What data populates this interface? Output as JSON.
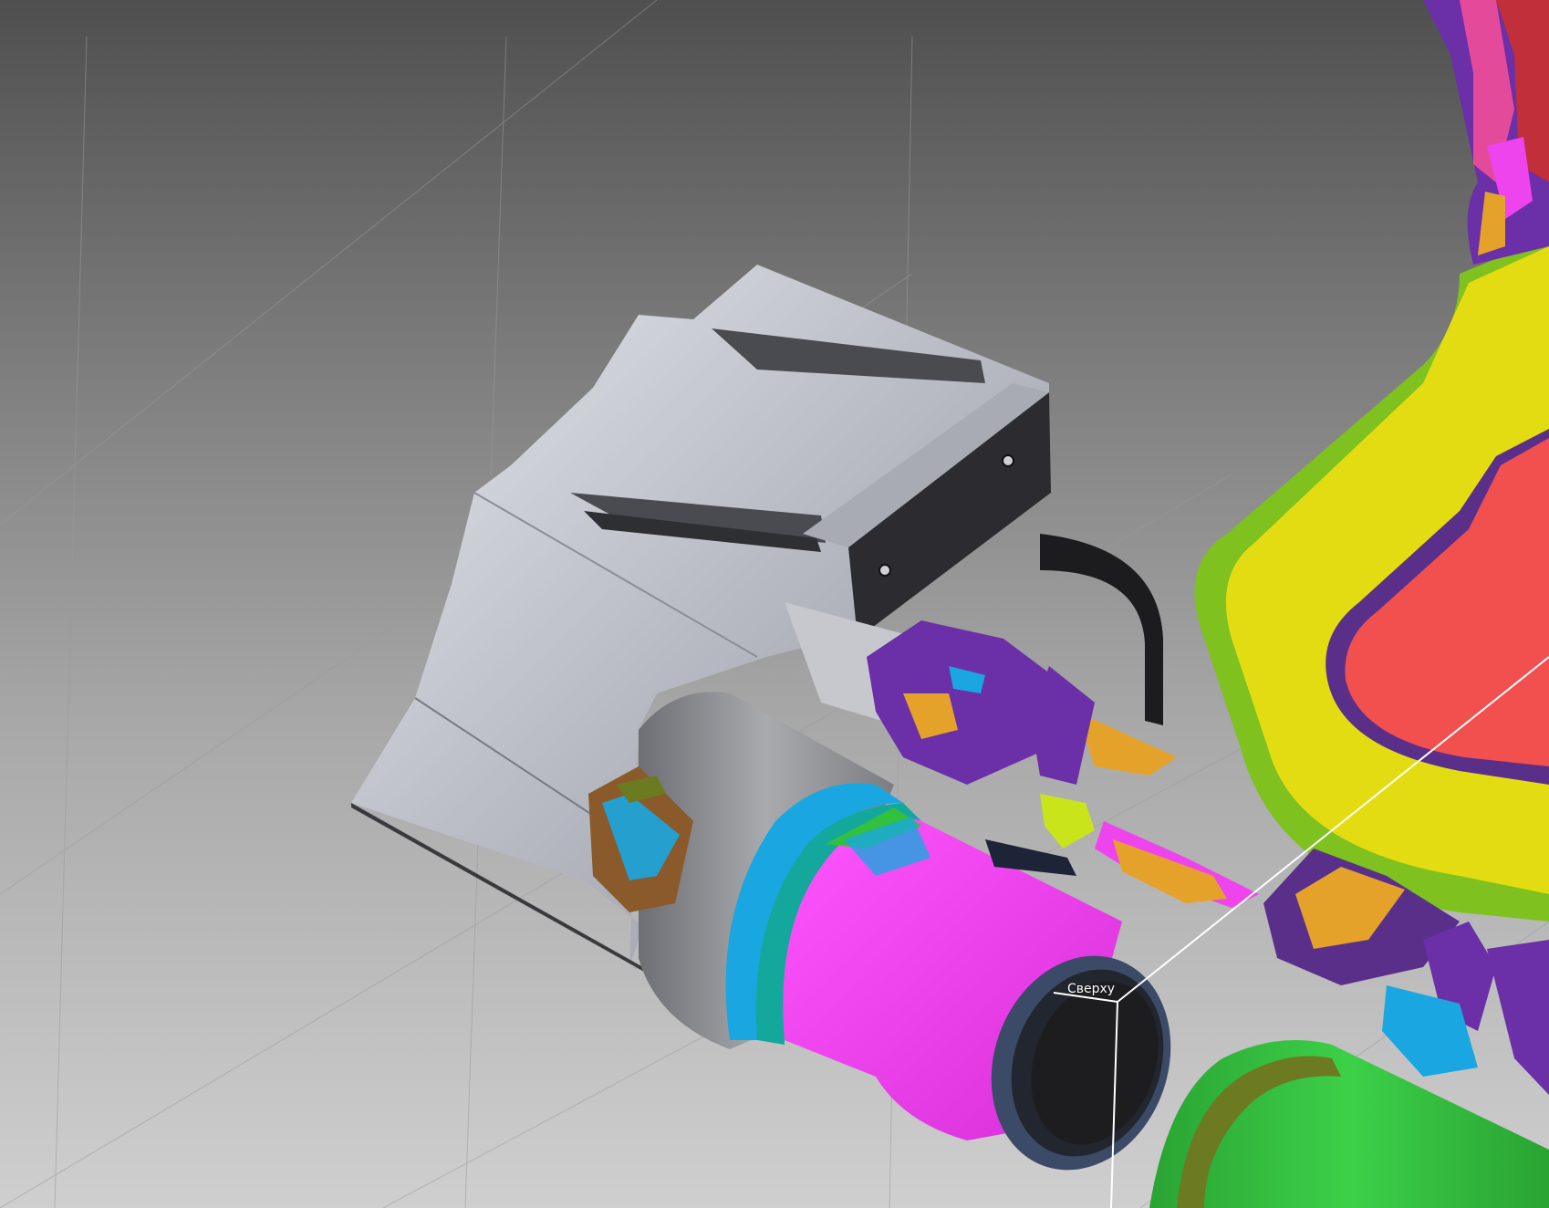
{
  "viewport": {
    "plane_label": "Сверху"
  },
  "colors": {
    "background_top": "#4f4f4f",
    "background_bottom": "#cfcfcf",
    "part_gray": "#b9bcc4",
    "part_dark": "#2c2c30",
    "mesh_yellow": "#e4dc12",
    "mesh_red": "#f24f4f",
    "mesh_magenta": "#ee44ee",
    "mesh_green": "#33c03e",
    "mesh_cyan": "#1aa6e0",
    "mesh_purple": "#6b2fa8",
    "mesh_orange": "#e5a22a"
  }
}
